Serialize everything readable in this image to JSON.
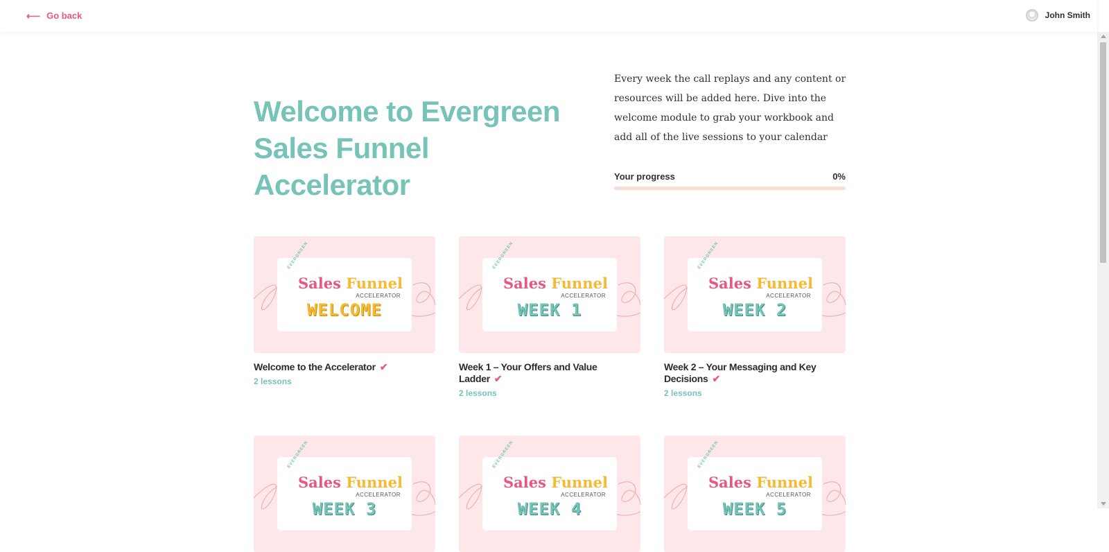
{
  "header": {
    "back_label": "Go back",
    "user_name": "John Smith"
  },
  "hero": {
    "title": "Welcome to Evergreen Sales Funnel Accelerator",
    "description": "Every week the call replays and any content or resources will be added here. Dive into the welcome module to grab your workbook and add all of the live sessions to your calendar",
    "progress_label": "Your progress",
    "progress_value": "0%",
    "progress_fraction": 0
  },
  "thumbnail": {
    "evergreen": "EVERGREEN",
    "word1": "Sales",
    "word2": "Funnel",
    "accelerator": "ACCELERATOR"
  },
  "modules": [
    {
      "tag": "WELCOME",
      "title": "Welcome to the Accelerator",
      "lessons": "2 lessons",
      "completed": true
    },
    {
      "tag": "WEEK 1",
      "title": "Week 1 – Your Offers and Value Ladder",
      "lessons": "2 lessons",
      "completed": true
    },
    {
      "tag": "WEEK 2",
      "title": "Week 2 – Your Messaging and Key Decisions",
      "lessons": "2 lessons",
      "completed": true
    },
    {
      "tag": "WEEK 3",
      "title": "",
      "lessons": "",
      "completed": false
    },
    {
      "tag": "WEEK 4",
      "title": "",
      "lessons": "",
      "completed": false
    },
    {
      "tag": "WEEK 5",
      "title": "",
      "lessons": "",
      "completed": false
    }
  ],
  "colors": {
    "accent_pink": "#e8577f",
    "accent_teal": "#76c3b8",
    "accent_yellow": "#f5b932",
    "card_bg": "#fde7e8"
  },
  "icons": {
    "back": "arrow-left-icon",
    "check": "checkmark-icon",
    "avatar": "user-avatar"
  }
}
